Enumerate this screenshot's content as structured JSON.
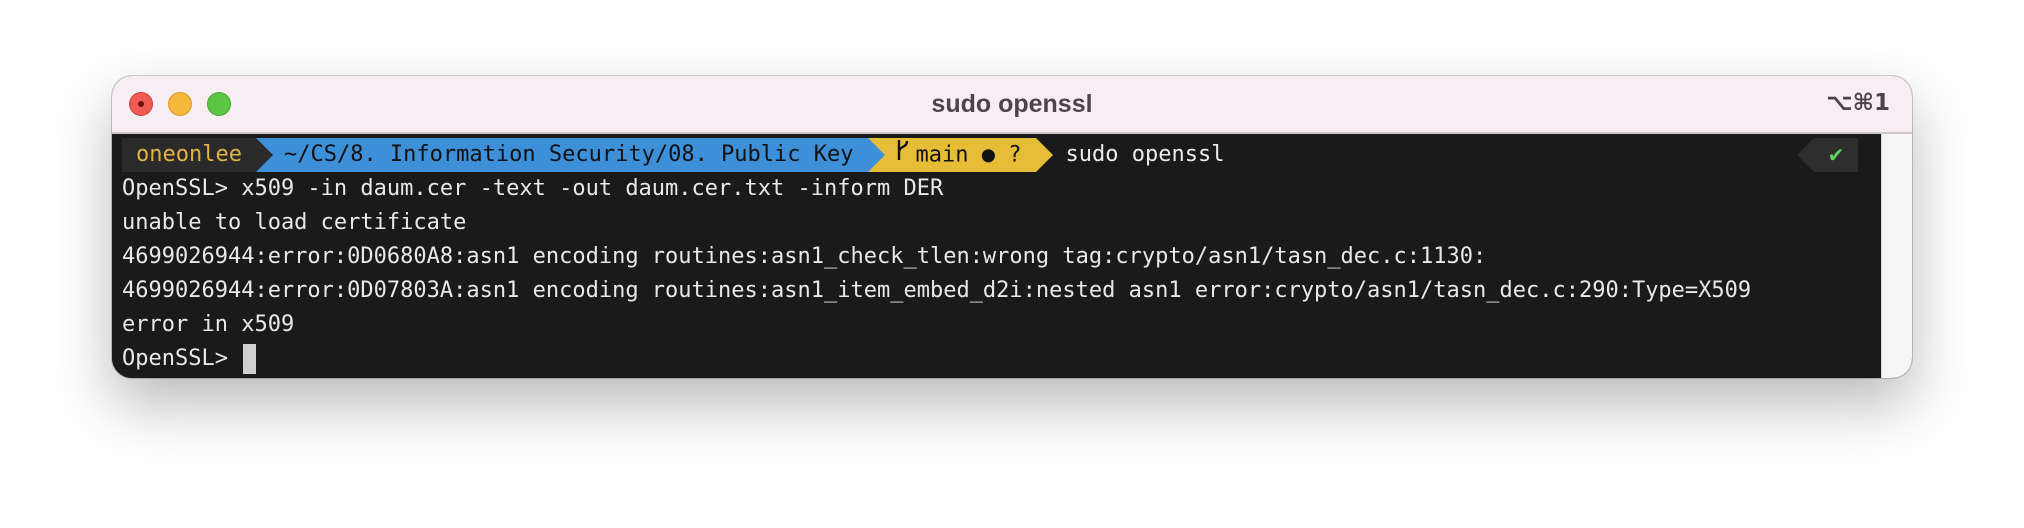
{
  "window": {
    "title": "sudo openssl",
    "shortcut": "⌥⌘1"
  },
  "prompt": {
    "user": "oneonlee",
    "path": "~/CS/8. Information Security/08. Public Key",
    "branch": "main",
    "git_status": "● ?",
    "command": "sudo openssl",
    "status_mark": "✔"
  },
  "output": [
    "OpenSSL> x509 -in daum.cer -text -out daum.cer.txt -inform DER",
    "unable to load certificate",
    "4699026944:error:0D0680A8:asn1 encoding routines:asn1_check_tlen:wrong tag:crypto/asn1/tasn_dec.c:1130:",
    "4699026944:error:0D07803A:asn1 encoding routines:asn1_item_embed_d2i:nested asn1 error:crypto/asn1/tasn_dec.c:290:Type=X509",
    "error in x509"
  ],
  "current_prompt": "OpenSSL> ",
  "colors": {
    "user_fg": "#e2b33f",
    "path_bg": "#3d8fd8",
    "git_bg": "#e6bd37",
    "status_ok": "#5fd35f"
  }
}
